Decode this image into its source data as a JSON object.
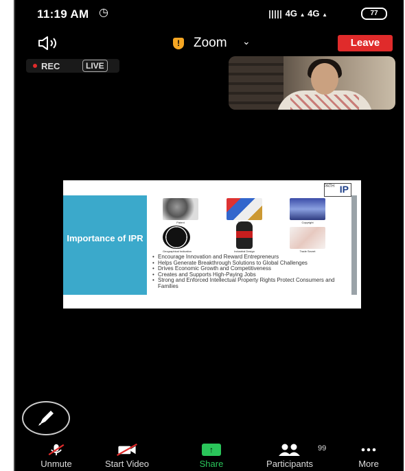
{
  "status_bar": {
    "time": "11:19 AM",
    "network": "4G",
    "network_secondary": "4G",
    "battery": "77"
  },
  "meeting": {
    "title": "Zoom",
    "leave_label": "Leave",
    "rec_label": "REC",
    "live_label": "LIVE"
  },
  "slide": {
    "heading": "Importance of IPR",
    "logo_text": "IP",
    "logo_subtext": "PATH",
    "image_captions": [
      "Patent",
      "Trademark",
      "Copyright",
      "Geographical Indication",
      "Industrial Design",
      "Trade Secret"
    ],
    "bullets": [
      "Encourage Innovation and Reward Entrepreneurs",
      "Helps Generate Breakthrough Solutions to Global Challenges",
      "Drives Economic Growth and Competitiveness",
      "Creates and Supports High-Paying Jobs",
      "Strong and Enforced Intellectual Property Rights Protect Consumers and Families"
    ]
  },
  "toolbar": {
    "unmute_label": "Unmute",
    "start_video_label": "Start Video",
    "share_label": "Share",
    "participants_label": "Participants",
    "participants_count": "99",
    "more_label": "More"
  },
  "colors": {
    "leave": "#e02b2b",
    "share": "#2ac55a",
    "shield": "#f5a623",
    "slide_panel": "#3ba9cb"
  },
  "icons": [
    "alarm-icon",
    "speaker-icon",
    "shield-icon",
    "chevron-down-icon",
    "pen-icon",
    "mic-off-icon",
    "video-off-icon",
    "share-arrow-icon",
    "participants-icon",
    "more-dots-icon"
  ]
}
